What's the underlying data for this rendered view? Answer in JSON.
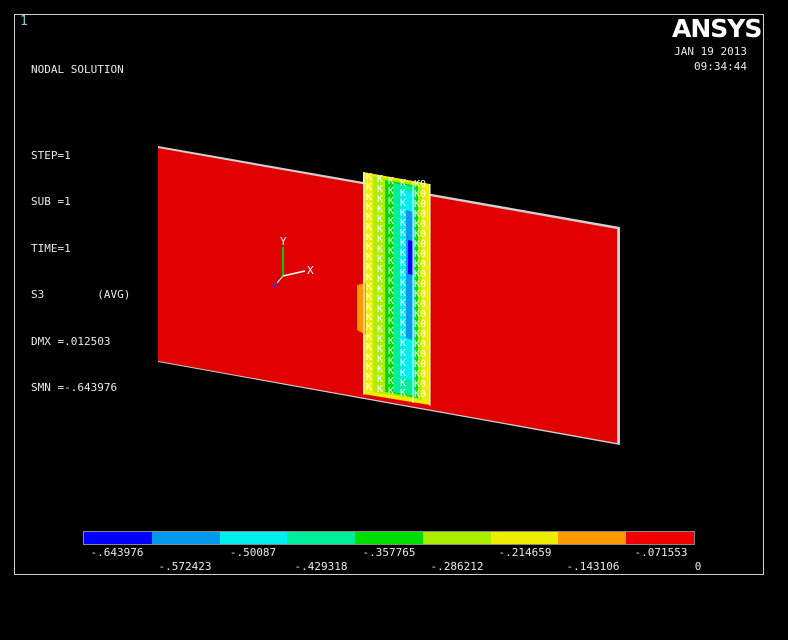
{
  "window_number": "1",
  "header": {
    "title": "NODAL SOLUTION",
    "lines": [
      "STEP=1",
      "SUB =1",
      "TIME=1",
      "S3        (AVG)",
      "DMX =.012503",
      "SMN =-.643976"
    ]
  },
  "logo": {
    "part1": "AN",
    "part2": "SYS"
  },
  "date": "JAN 19 2013",
  "time": "09:34:44",
  "triad": {
    "x_label": "X",
    "y_label": "Y"
  },
  "contour_node_label": "K",
  "contour_node_label_right": "K0",
  "legend": {
    "colors": [
      "#0000ff",
      "#0099ee",
      "#00eeee",
      "#00ee99",
      "#00dd00",
      "#aaee00",
      "#eeee00",
      "#ff9900",
      "#ee0000"
    ],
    "labels_top": [
      "-.643976",
      "-.50087",
      "-.357765",
      "-.214659",
      "-.071553"
    ],
    "labels_bottom": [
      "-.572423",
      "-.429318",
      "-.286212",
      "-.143106",
      "0"
    ]
  }
}
